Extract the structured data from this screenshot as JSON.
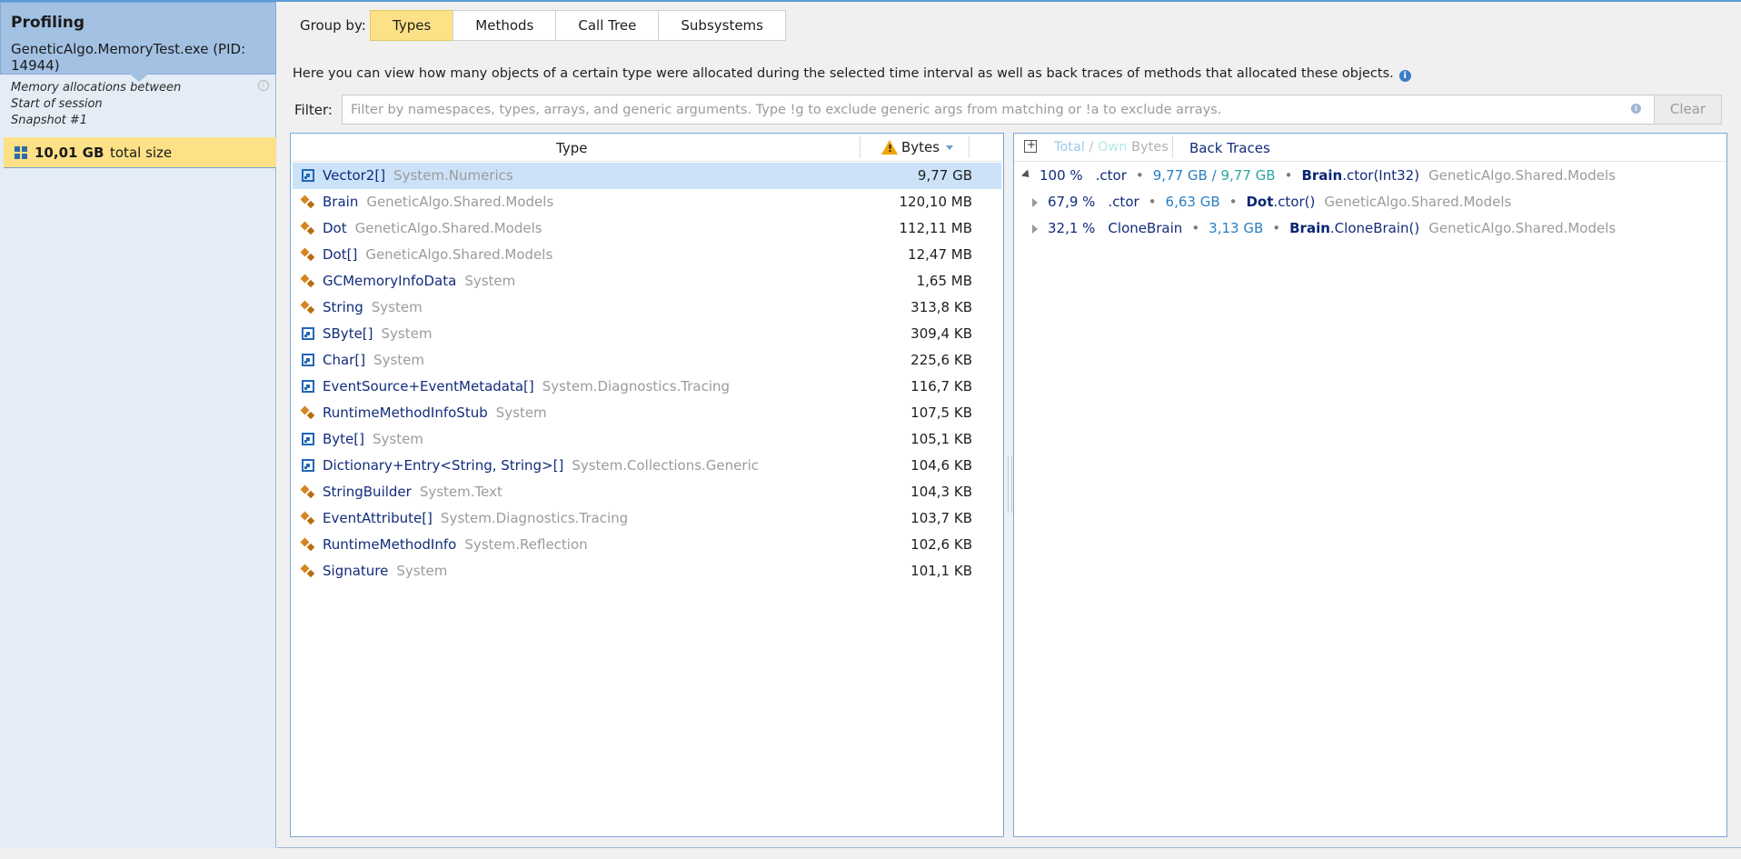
{
  "sidebar": {
    "title": "Profiling",
    "process": "GeneticAlgo.MemoryTest.exe (PID: 14944)",
    "range_line1": "Memory allocations between",
    "range_line2": "Start of session",
    "range_line3": "Snapshot #1",
    "snapshot_size": "10,01 GB",
    "snapshot_size_label": "total size"
  },
  "toolbar": {
    "group_by_label": "Group by:",
    "tabs": [
      {
        "label": "Types",
        "active": true
      },
      {
        "label": "Methods",
        "active": false
      },
      {
        "label": "Call Tree",
        "active": false
      },
      {
        "label": "Subsystems",
        "active": false
      }
    ]
  },
  "help_text": "Here you can view how many objects of a certain type were allocated during the selected time interval as well as back traces of methods that allocated these objects.",
  "filter": {
    "label": "Filter:",
    "value": "",
    "placeholder": "Filter by namespaces, types, arrays, and generic arguments. Type !g to exclude generic args from matching or !a to exclude arrays.",
    "clear_label": "Clear"
  },
  "types_table": {
    "col_type": "Type",
    "col_bytes": "Bytes",
    "rows": [
      {
        "name": "Vector2[]",
        "ns": "System.Numerics",
        "bytes": "9,77 GB",
        "kind": "array",
        "selected": true
      },
      {
        "name": "Brain",
        "ns": "GeneticAlgo.Shared.Models",
        "bytes": "120,10 MB",
        "kind": "class"
      },
      {
        "name": "Dot",
        "ns": "GeneticAlgo.Shared.Models",
        "bytes": "112,11 MB",
        "kind": "class"
      },
      {
        "name": "Dot[]",
        "ns": "GeneticAlgo.Shared.Models",
        "bytes": "12,47 MB",
        "kind": "class"
      },
      {
        "name": "GCMemoryInfoData",
        "ns": "System",
        "bytes": "1,65 MB",
        "kind": "class"
      },
      {
        "name": "String",
        "ns": "System",
        "bytes": "313,8 KB",
        "kind": "class"
      },
      {
        "name": "SByte[]",
        "ns": "System",
        "bytes": "309,4 KB",
        "kind": "array"
      },
      {
        "name": "Char[]",
        "ns": "System",
        "bytes": "225,6 KB",
        "kind": "array"
      },
      {
        "name": "EventSource+EventMetadata[]",
        "ns": "System.Diagnostics.Tracing",
        "bytes": "116,7 KB",
        "kind": "array"
      },
      {
        "name": "RuntimeMethodInfoStub",
        "ns": "System",
        "bytes": "107,5 KB",
        "kind": "class"
      },
      {
        "name": "Byte[]",
        "ns": "System",
        "bytes": "105,1 KB",
        "kind": "array"
      },
      {
        "name": "Dictionary+Entry<String, String>[]",
        "ns": "System.Collections.Generic",
        "bytes": "104,6 KB",
        "kind": "array"
      },
      {
        "name": "StringBuilder",
        "ns": "System.Text",
        "bytes": "104,3 KB",
        "kind": "class"
      },
      {
        "name": "EventAttribute[]",
        "ns": "System.Diagnostics.Tracing",
        "bytes": "103,7 KB",
        "kind": "class"
      },
      {
        "name": "RuntimeMethodInfo",
        "ns": "System.Reflection",
        "bytes": "102,6 KB",
        "kind": "class"
      },
      {
        "name": "Signature",
        "ns": "System",
        "bytes": "101,1 KB",
        "kind": "class"
      }
    ]
  },
  "back_traces": {
    "metric_total": "Total",
    "metric_sep": "/",
    "metric_own": "Own",
    "metric_bytes": "Bytes",
    "title": "Back Traces",
    "rows": [
      {
        "pct": "100 %",
        "method": ".ctor",
        "size": "9,77 GB",
        "size_sep": "/",
        "size_own": "9,77 GB",
        "cls": "Brain",
        "desc": ".ctor(Int32)",
        "ns": "GeneticAlgo.Shared.Models",
        "expanded": true,
        "level": 0
      },
      {
        "pct": "67,9 %",
        "method": ".ctor",
        "size": "6,63 GB",
        "cls": "Dot",
        "desc": ".ctor()",
        "ns": "GeneticAlgo.Shared.Models",
        "expanded": false,
        "level": 1
      },
      {
        "pct": "32,1 %",
        "method": "CloneBrain",
        "size": "3,13 GB",
        "cls": "Brain",
        "desc": ".CloneBrain()",
        "ns": "GeneticAlgo.Shared.Models",
        "expanded": false,
        "level": 1
      }
    ]
  },
  "colors": {
    "accent_yellow": "#fce186",
    "header_blue": "#a3c1e3",
    "link_blue": "#112c7a",
    "size_blue": "#2a7ec2",
    "own_teal": "#28a8a0"
  }
}
